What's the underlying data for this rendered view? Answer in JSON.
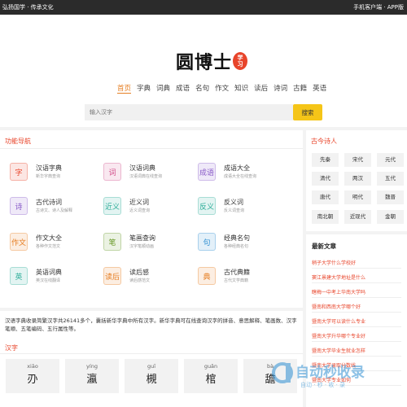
{
  "topbar": {
    "left": "弘扬国学 · 传承文化",
    "right": "手机客户端 · APP版"
  },
  "logo": {
    "text": "圆博士",
    "seal_top": "学",
    "seal_bottom": "习"
  },
  "nav": [
    "首页",
    "字典",
    "词典",
    "成语",
    "名句",
    "作文",
    "知识",
    "读后",
    "诗词",
    "古籍",
    "英语"
  ],
  "search": {
    "placeholder": "输入汉字",
    "button": "搜索"
  },
  "func_nav": {
    "title": "功能导航",
    "items": [
      {
        "icon": "字",
        "name": "汉语字典",
        "desc": "新华字典查询",
        "color": "#e8442a"
      },
      {
        "icon": "词",
        "name": "汉语词典",
        "desc": "汉语词典在线查询",
        "color": "#d2508c"
      },
      {
        "icon": "成语",
        "name": "成语大全",
        "desc": "成语大全在线查询",
        "color": "#8a5cc8"
      },
      {
        "icon": "诗",
        "name": "古代诗词",
        "desc": "古诗文、诗人及解释",
        "color": "#8a5cc8"
      },
      {
        "icon": "近义",
        "name": "近义词",
        "desc": "近义词查询",
        "color": "#2fae9a"
      },
      {
        "icon": "反义",
        "name": "反义词",
        "desc": "反义词查询",
        "color": "#2fae9a"
      },
      {
        "icon": "作文",
        "name": "作文大全",
        "desc": "各种作文范文",
        "color": "#e67e22"
      },
      {
        "icon": "笔",
        "name": "笔画查询",
        "desc": "汉字笔顺动画",
        "color": "#6a9a2a"
      },
      {
        "icon": "句",
        "name": "经典名句",
        "desc": "各种经典名句",
        "color": "#2f8fd2"
      },
      {
        "icon": "英",
        "name": "英语词典",
        "desc": "英汉在线翻译",
        "color": "#2fae9a"
      },
      {
        "icon": "读后",
        "name": "读后感",
        "desc": "读后感范文",
        "color": "#e67e22"
      },
      {
        "icon": "典",
        "name": "古代典籍",
        "desc": "古代文学典籍",
        "color": "#e67e22"
      }
    ]
  },
  "poets": {
    "title": "古今诗人",
    "tags": [
      "先秦",
      "宋代",
      "元代",
      "清代",
      "两汉",
      "五代",
      "唐代",
      "明代",
      "魏晋",
      "南北朝",
      "近现代",
      "金朝"
    ]
  },
  "articles": {
    "title": "最新文章",
    "items": [
      "稍子大学什么学校好",
      "窦江景建大学地址是什么",
      "瞎梅一中考上华南大学吗",
      "暨南和西南大学哪个好",
      "暨南大学可以读什么专业",
      "暨南大学升华哪个专业好",
      "暨南大学毕业生就业怎样",
      "暨南大学录取分数线",
      "暨南大学专业如何"
    ]
  },
  "intro": "汉语字典收录简繁汉字共26141多个，囊括新华字典中所有汉字。新华字典可在线查询汉字的拼音、意思解释、笔画数、汉字笔顺、五笔编码、五行属性等。",
  "hanzi": {
    "title": "汉字",
    "cards": [
      {
        "pinyin": "xiāo",
        "char": "刅"
      },
      {
        "pinyin": "yíng",
        "char": "瀛"
      },
      {
        "pinyin": "guī",
        "char": "槻"
      },
      {
        "pinyin": "guǎn",
        "char": "棺"
      },
      {
        "pinyin": "bà",
        "char": "舚"
      }
    ]
  },
  "watermark": {
    "text": "自动秒收录",
    "sub": "自动 · 秒 · 收 · 录"
  }
}
